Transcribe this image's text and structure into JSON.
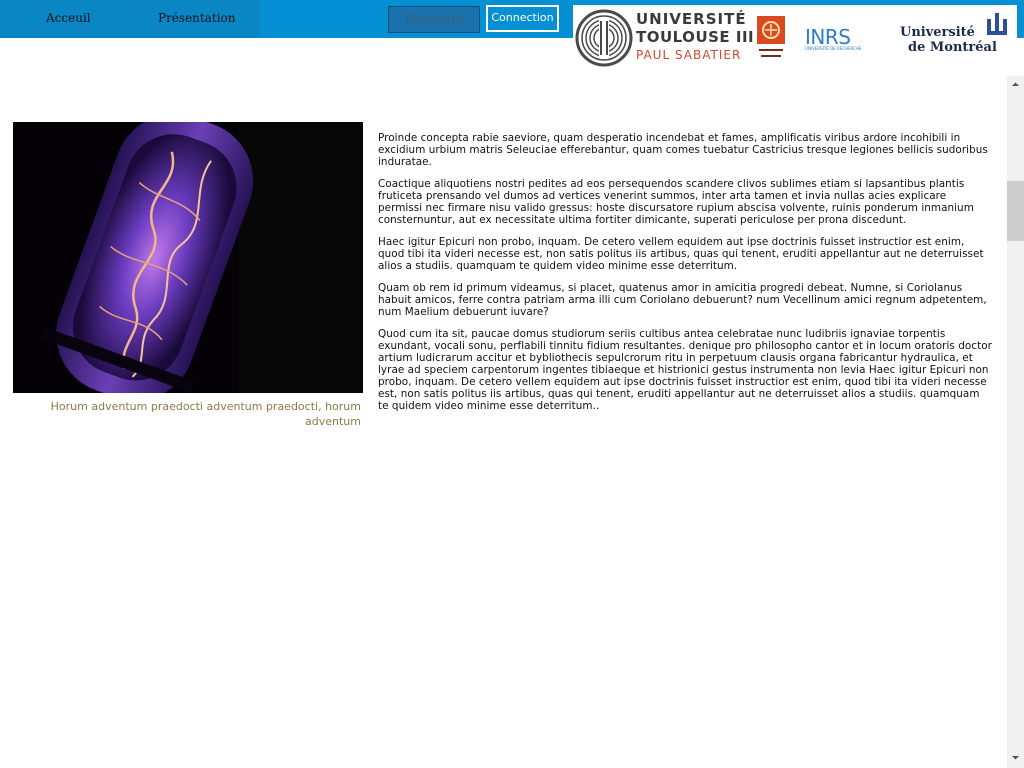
{
  "nav": {
    "accueil": "Acceuil",
    "presentation": "Présentation",
    "plaquette": "Plaquette",
    "connexion": "Connection"
  },
  "logos": {
    "ut_line1": "UNIVERSITÉ",
    "ut_line2": "TOULOUSE III",
    "ut_line3": "PAUL SABATIER",
    "ut_badge_text": "Université de Toulouse",
    "inrs": "INRS",
    "inrs_sub": "UNIVERSITÉ DE RECHERCHE",
    "udm_line1": "Université",
    "udm_line2": "de Montréal"
  },
  "figure": {
    "caption": "Horum adventum praedocti adventum praedocti, horum adventum"
  },
  "article": {
    "paragraphs": [
      "Proinde concepta rabie saeviore, quam desperatio incendebat et fames, amplificatis viribus ardore incohibili in excidium urbium matris Seleuciae efferebantur, quam comes tuebatur Castricius tresque legiones bellicis sudoribus induratae.",
      "Coactique aliquotiens nostri pedites ad eos persequendos scandere clivos sublimes etiam si lapsantibus plantis fruticeta prensando vel dumos ad vertices venerint summos, inter arta tamen et invia nullas acies explicare permissi nec firmare nisu valido gressus: hoste discursatore rupium abscisa volvente, ruinis ponderum inmanium consternuntur, aut ex necessitate ultima fortiter dimicante, superati periculose per prona discedunt.",
      "Haec igitur Epicuri non probo, inquam. De cetero vellem equidem aut ipse doctrinis fuisset instructior est enim, quod tibi ita videri necesse est, non satis politus iis artibus, quas qui tenent, eruditi appellantur aut ne deterruisset alios a studiis. quamquam te quidem video minime esse deterritum.",
      "Quam ob rem id primum videamus, si placet, quatenus amor in amicitia progredi debeat. Numne, si Coriolanus habuit amicos, ferre contra patriam arma illi cum Coriolano debuerunt? num Vecellinum amici regnum adpetentem, num Maelium debuerunt iuvare?",
      "Quod cum ita sit, paucae domus studiorum seriis cultibus antea celebratae nunc ludibriis ignaviae torpentis exundant, vocali sonu, perflabili tinnitu fidium resultantes. denique pro philosopho cantor et in locum oratoris doctor artium ludicrarum accitur et bybliothecis sepulcrorum ritu in perpetuum clausis organa fabricantur hydraulica, et lyrae ad speciem carpentorum ingentes tibiaeque et histrionici gestus instrumenta non levia Haec igitur Epicuri non probo, inquam. De cetero vellem equidem aut ipse doctrinis fuisset instructior est enim, quod tibi ita videri necesse est, non satis politus iis artibus, quas qui tenent, eruditi appellantur aut ne deterruisset alios a studiis. quamquam te quidem video minime esse deterritum.."
    ]
  },
  "colors": {
    "topbar": "#0690d4",
    "nav_left": "#0a86c4",
    "caption": "#8c7b43",
    "inrs": "#2f7dc6",
    "ut_accent": "#d0492f"
  },
  "icons": {
    "scroll_up": "chevron-up-icon",
    "scroll_down": "chevron-down-icon",
    "ut_seal": "university-seal-icon",
    "udm_mark": "montreal-emblem-icon"
  }
}
